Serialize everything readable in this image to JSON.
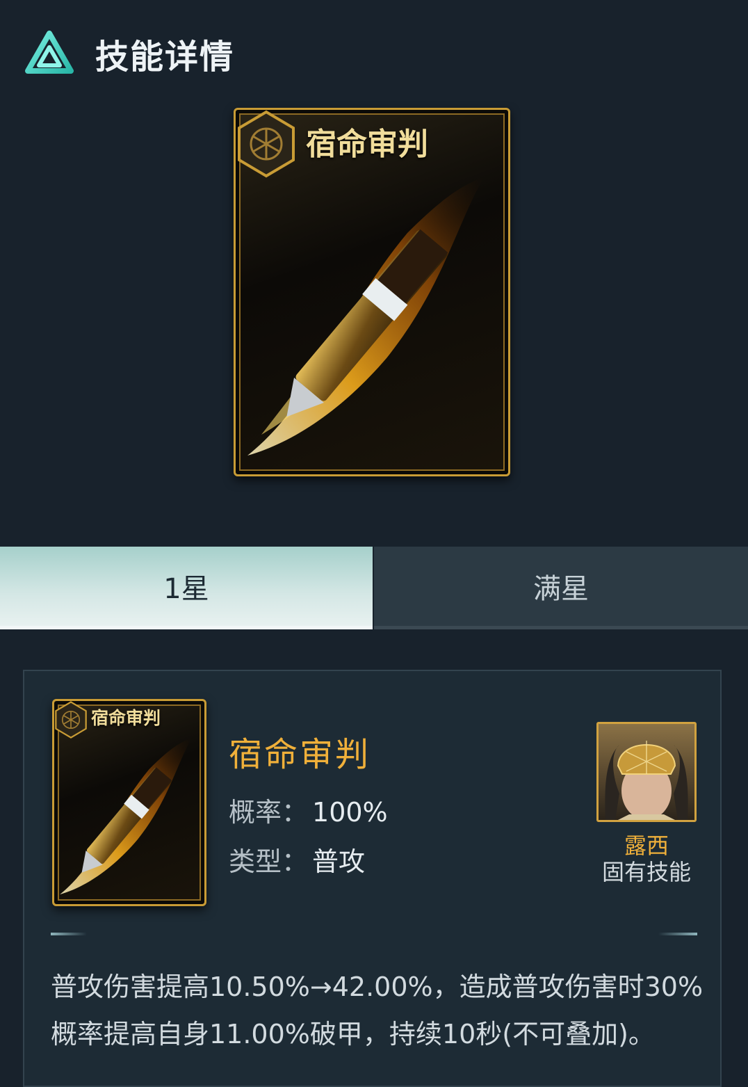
{
  "header": {
    "title": "技能详情",
    "logo_icon": "triangle-logo-icon"
  },
  "card": {
    "title": "宿命审判",
    "badge_icon": "hexagon-rune-icon",
    "art_icon": "flaming-bullet-icon"
  },
  "tabs": [
    {
      "label": "1星",
      "selected": true
    },
    {
      "label": "满星",
      "selected": false
    }
  ],
  "detail": {
    "name": "宿命审判",
    "chance_label": "概率：",
    "chance_value": "100%",
    "type_label": "类型：",
    "type_value": "普攻",
    "hero_name": "露西",
    "hero_tag": "固有技能",
    "description_line1": "普攻伤害提高10.50%→42.00%，造成普攻伤害时30%",
    "description_line2": "概率提高自身11.00%破甲，持续10秒(不可叠加)。"
  },
  "colors": {
    "accent_gold": "#f0b03a",
    "tab_active": "#d4e7e5",
    "background": "#18222c"
  }
}
